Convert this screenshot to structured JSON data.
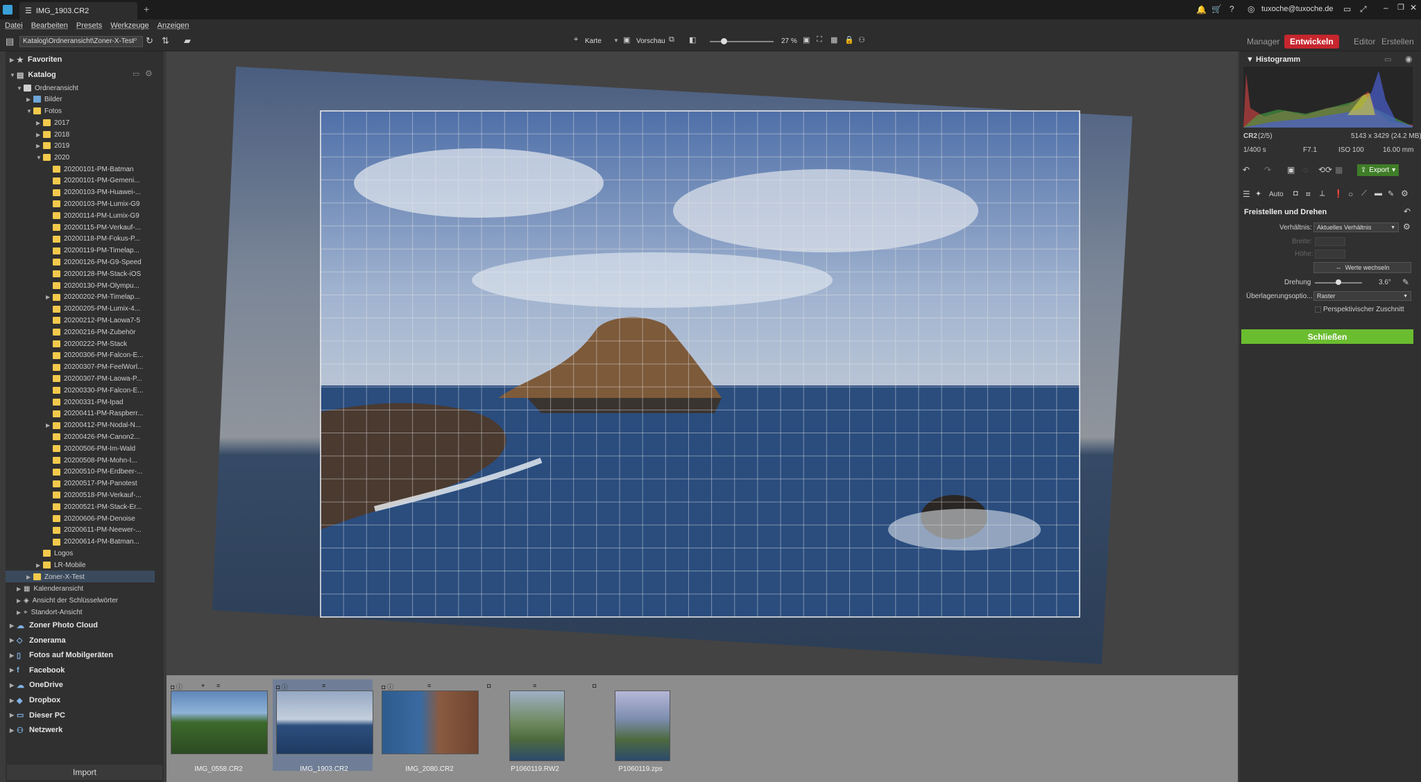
{
  "window": {
    "doc_tab": "IMG_1903.CR2",
    "user": "tuxoche@tuxoche.de"
  },
  "menu": [
    "Datei",
    "Bearbeiten",
    "Presets",
    "Werkzeuge",
    "Anzeigen"
  ],
  "toolbar": {
    "path": "Katalog\\Ordneransicht\\Zoner-X-Test",
    "map_label": "Karte",
    "preview_label": "Vorschau",
    "zoom": "27 %",
    "modes": [
      "Manager",
      "Entwickeln",
      "Editor",
      "Erstellen"
    ]
  },
  "left": {
    "favorites": "Favoriten",
    "catalog": "Katalog",
    "folder_view": "Ordneransicht",
    "bilder": "Bilder",
    "fotos": "Fotos",
    "years": [
      "2017",
      "2018",
      "2019",
      "2020"
    ],
    "folders2020": [
      "20200101-PM-Batman",
      "20200101-PM-Gemeni...",
      "20200103-PM-Huawei-...",
      "20200103-PM-Lumix-G9",
      "20200114-PM-Lumix-G9",
      "20200115-PM-Verkauf-...",
      "20200118-PM-Fokus-P...",
      "20200119-PM-Timelap...",
      "20200126-PM-G9-Speed",
      "20200128-PM-Stack-iOS",
      "20200130-PM-Olympu...",
      "20200202-PM-Timelap...",
      "20200205-PM-Lumix-4...",
      "20200212-PM-Laowa7-5",
      "20200216-PM-Zubehör",
      "20200222-PM-Stack",
      "20200306-PM-Falcon-E...",
      "20200307-PM-FeelWorl...",
      "20200307-PM-Laowa-P...",
      "20200330-PM-Falcon-E...",
      "20200331-PM-Ipad",
      "20200411-PM-Raspberr...",
      "20200412-PM-Nodal-N...",
      "20200426-PM-Canon2...",
      "20200506-PM-Im-Wald",
      "20200508-PM-Mohn-I...",
      "20200510-PM-Erdbeer-...",
      "20200517-PM-Panotest",
      "20200518-PM-Verkauf-...",
      "20200521-PM-Stack-Er...",
      "20200606-PM-Denoise",
      "20200611-PM-Neewer-...",
      "20200614-PM-Batman..."
    ],
    "logos": "Logos",
    "lr_mobile": "LR-Mobile",
    "zoner_test": "Zoner-X-Test",
    "calendar": "Kalenderansicht",
    "keywords": "Ansicht der Schlüsselwörter",
    "location": "Standort-Ansicht",
    "sections": [
      "Zoner Photo Cloud",
      "Zonerama",
      "Fotos auf Mobilgeräten",
      "Facebook",
      "OneDrive",
      "Dropbox",
      "Dieser PC",
      "Netzwerk"
    ],
    "import": "Import"
  },
  "filmstrip": [
    {
      "name": "IMG_0558.CR2"
    },
    {
      "name": "IMG_1903.CR2"
    },
    {
      "name": "IMG_2080.CR2"
    },
    {
      "name": "P1060119.RW2"
    },
    {
      "name": "P1060119.zps"
    }
  ],
  "right": {
    "histogram_title": "Histogramm",
    "format": "CR2",
    "index": "(2/5)",
    "dimensions": "5143 x 3429 (24.2 MB)",
    "shutter": "1/400 s",
    "aperture": "F7.1",
    "iso": "ISO 100",
    "focal": "16.00 mm",
    "export": "Export",
    "auto": "Auto",
    "crop_title": "Freistellen und Drehen",
    "ratio_label": "Verhältnis:",
    "ratio_value": "Aktuelles Verhältnis",
    "width_label": "Breite:",
    "height_label": "Höhe:",
    "swap": "Werte wechseln",
    "rotation_label": "Drehung",
    "rotation_value": "3.6°",
    "overlay_label": "Überlagerungsoptio...",
    "overlay_value": "Raster",
    "perspective": "Perspektivischer Zuschnitt",
    "close": "Schließen"
  },
  "colors": {
    "accent_red": "#c7262e",
    "accent_green": "#6bbd30",
    "folder": "#f2c94c"
  }
}
